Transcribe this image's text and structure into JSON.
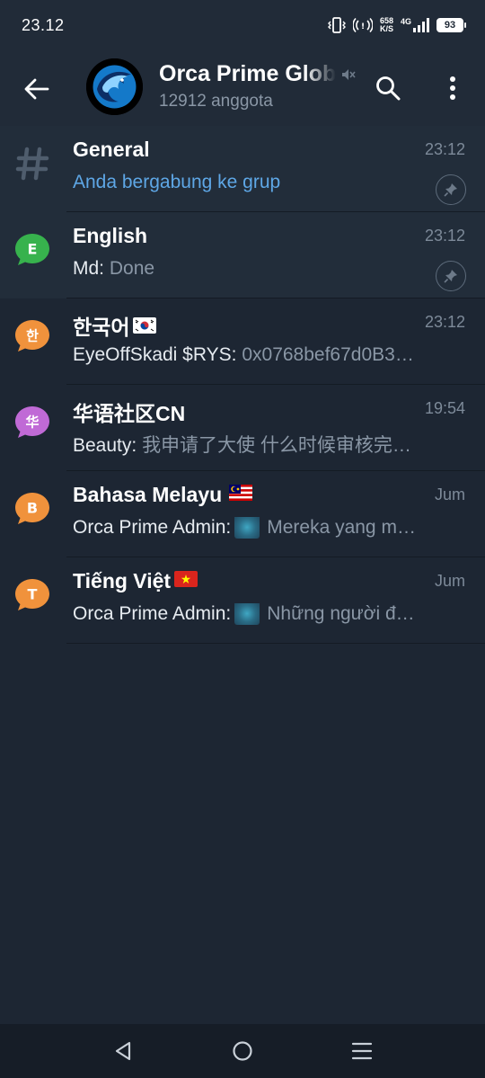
{
  "status_bar": {
    "time": "23.12",
    "net_speed_value": "658",
    "net_speed_unit": "K/S",
    "network": "4G",
    "battery": "93"
  },
  "header": {
    "title": "Orca Prime Global",
    "members": "12912 anggota",
    "icons": [
      "back-arrow-icon",
      "muted-speaker-icon",
      "search-icon",
      "more-vert-icon"
    ]
  },
  "topics": [
    {
      "name": "General",
      "time": "23:12",
      "preview_sender": "",
      "preview_text": "Anda bergabung ke grup",
      "pinned": true,
      "icon": "hash-icon"
    },
    {
      "name": "English",
      "time": "23:12",
      "preview_sender": "Md:",
      "preview_text": "Done",
      "pinned": true,
      "icon_letter": "E",
      "icon_color": "#37b24d"
    },
    {
      "name": "한국어",
      "time": "23:12",
      "preview_sender": "EyeOffSkadi $RYS:",
      "preview_text": "0x0768bef67d0B3…",
      "pinned": false,
      "icon_letter": "한",
      "icon_color": "#f0923c",
      "flag": "kr"
    },
    {
      "name": "华语社区CN",
      "time": "19:54",
      "preview_sender": "Beauty:",
      "preview_text": "我申请了大使 什么时候审核完…",
      "pinned": false,
      "icon_letter": "华",
      "icon_color": "#c06ad6"
    },
    {
      "name": "Bahasa Melayu",
      "time": "Jum",
      "preview_sender": "Orca Prime Admin:",
      "preview_text": "Mereka yang m…",
      "pinned": false,
      "icon_letter": "B",
      "icon_color": "#f0923c",
      "flag": "my",
      "has_thumbnail": true
    },
    {
      "name": "Tiếng Việt",
      "time": "Jum",
      "preview_sender": "Orca Prime Admin:",
      "preview_text": "Những người đ…",
      "pinned": false,
      "icon_letter": "T",
      "icon_color": "#f0923c",
      "flag": "vn",
      "has_thumbnail": true
    }
  ],
  "nav_bar": {
    "icons": [
      "nav-back-icon",
      "nav-home-icon",
      "nav-recents-icon"
    ]
  },
  "colors": {
    "background": "#1d2633",
    "header": "#212b38",
    "accent_link": "#5ea7e6",
    "muted_text": "#8a97a6"
  }
}
